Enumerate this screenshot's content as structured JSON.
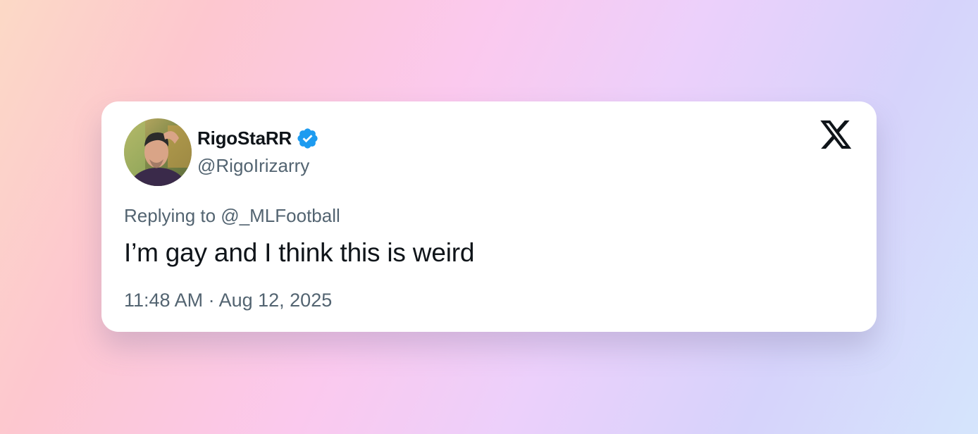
{
  "tweet": {
    "display_name": "RigoStaRR",
    "handle": "@RigoIrizarry",
    "replying_to": "Replying to @_MLFootball",
    "text": "I’m gay and I think this is weird",
    "timestamp": "11:48 AM · Aug 12, 2025"
  },
  "icons": {
    "verified": "verified-badge-icon",
    "platform": "x-logo-icon",
    "avatar": "user-avatar"
  },
  "colors": {
    "verified_blue": "#1d9bf0",
    "text_primary": "#0f1419",
    "text_secondary": "#536471",
    "card_background": "#ffffff"
  }
}
